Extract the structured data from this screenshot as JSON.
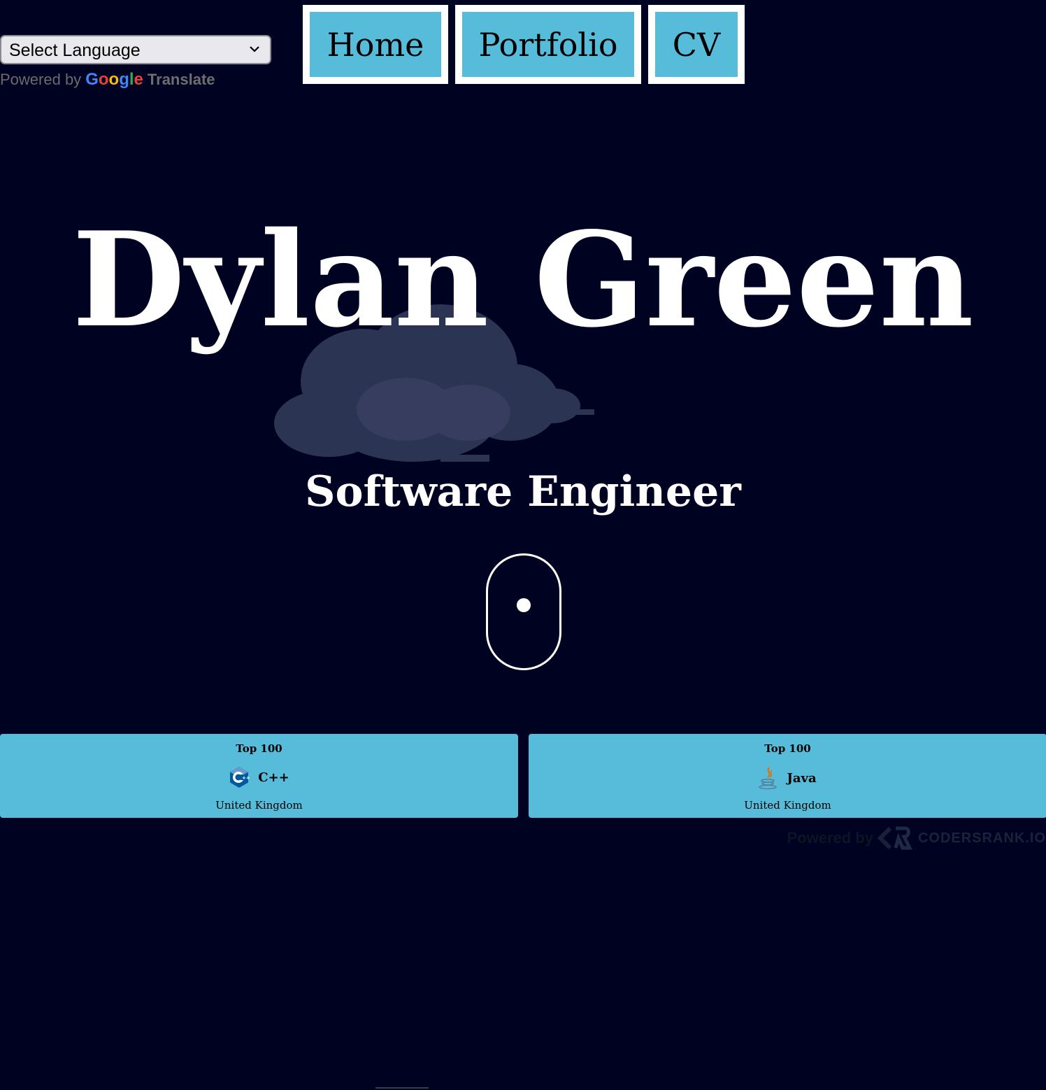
{
  "translate": {
    "select_value": "Select Language",
    "powered_by": "Powered by",
    "google": "Google",
    "translate_word": "Translate"
  },
  "nav": {
    "items": [
      "Home",
      "Portfolio",
      "CV"
    ]
  },
  "hero": {
    "name": "Dylan Green",
    "subtitle": "Software Engineer"
  },
  "badges": [
    {
      "rank": "Top 100",
      "language": "C++",
      "country": "United Kingdom",
      "icon": "cpp-icon"
    },
    {
      "rank": "Top 100",
      "language": "Java",
      "country": "United Kingdom",
      "icon": "java-icon"
    }
  ],
  "footer": {
    "powered_by": "Powered by",
    "brand": "CODERSRANK.IO"
  },
  "colors": {
    "background": "#000222",
    "accent": "#57bcd9",
    "text": "#ffffff"
  }
}
